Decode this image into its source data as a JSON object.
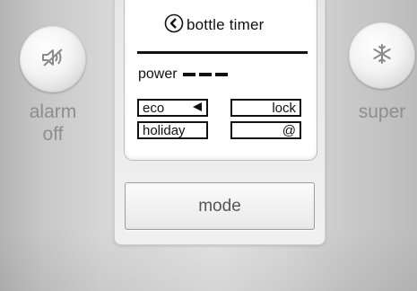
{
  "alarm": {
    "label_line1": "alarm",
    "label_line2": "off",
    "icon": "speaker-muted-icon"
  },
  "super": {
    "label": "super",
    "icon": "snowflake-icon"
  },
  "display": {
    "title": "bottle timer",
    "title_icon": "back-arrow-circle-icon",
    "power_label": "power",
    "power_dashes": 3,
    "eco_label": "eco",
    "eco_icon": "triangle-left-icon",
    "holiday_label": "holiday",
    "lock_label": "lock",
    "at_label": "@"
  },
  "mode_button": {
    "label": "mode"
  },
  "colors": {
    "text": "#111111",
    "side_label": "#8e8e8e",
    "button_text": "#555555"
  }
}
